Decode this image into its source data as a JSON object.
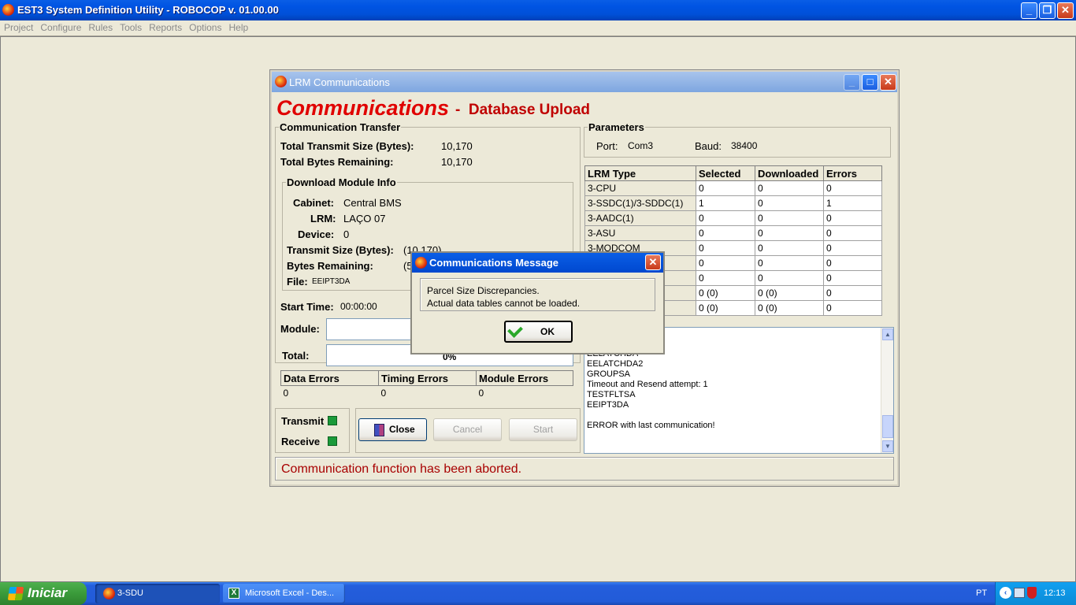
{
  "app": {
    "title": "EST3 System Definition Utility - ROBOCOP v. 01.00.00",
    "menu": [
      "Project",
      "Configure",
      "Rules",
      "Tools",
      "Reports",
      "Options",
      "Help"
    ]
  },
  "lrm": {
    "title": "LRM Communications",
    "heading": "Communications",
    "dash": "-",
    "subheading": "Database Upload",
    "transfer": {
      "legend": "Communication Transfer",
      "total_size_label": "Total Transmit Size (Bytes):",
      "total_size": "10,170",
      "total_remaining_label": "Total Bytes Remaining:",
      "total_remaining": "10,170"
    },
    "module": {
      "legend": "Download Module Info",
      "cabinet_label": "Cabinet:",
      "cabinet": "Central  BMS",
      "lrm_label": "LRM:",
      "lrm": "LAÇO 07",
      "device_label": "Device:",
      "device": "0",
      "size_label": "Transmit Size (Bytes):",
      "size": "(10,170)",
      "remaining_label": "Bytes Remaining:",
      "remaining": "(5",
      "file_label": "File:",
      "file": "EEIPT3DA"
    },
    "start_time_label": "Start Time:",
    "start_time": "00:00:00",
    "module_label": "Module:",
    "total_label": "Total:",
    "total_percent": "0%",
    "errors": {
      "headers": [
        "Data Errors",
        "Timing Errors",
        "Module Errors"
      ],
      "values": [
        "0",
        "0",
        "0"
      ]
    },
    "transmit_label": "Transmit",
    "receive_label": "Receive",
    "buttons": {
      "close": "Close",
      "cancel": "Cancel",
      "start": "Start"
    },
    "params": {
      "legend": "Parameters",
      "port_label": "Port:",
      "port": "Com3",
      "baud_label": "Baud:",
      "baud": "38400"
    },
    "table": {
      "headers": [
        "LRM Type",
        "Selected",
        "Downloaded",
        "Errors"
      ],
      "rows": [
        [
          "3-CPU",
          "0",
          "0",
          "0"
        ],
        [
          "3-SSDC(1)/3-SDDC(1)",
          "1",
          "0",
          "1"
        ],
        [
          "3-AADC(1)",
          "0",
          "0",
          "0"
        ],
        [
          "3-ASU",
          "0",
          "0",
          "0"
        ],
        [
          "3-MODCOM",
          "0",
          "0",
          "0"
        ],
        [
          "",
          "0",
          "0",
          "0"
        ],
        [
          "",
          "0",
          "0",
          "0"
        ],
        [
          "",
          "0 (0)",
          "0 (0)",
          "0"
        ],
        [
          "",
          "0 (0)",
          "0 (0)",
          "0"
        ]
      ]
    },
    "log": [
      "EELATCHDA",
      "EELATCHDA2",
      "GROUPSA",
      "Timeout and Resend attempt: 1",
      "TESTFLTSA",
      "EEIPT3DA",
      "",
      "ERROR with last communication!"
    ],
    "status": "Communication function has been aborted."
  },
  "dialog": {
    "title": "Communications Message",
    "line1": "Parcel Size Discrepancies.",
    "line2": "Actual data tables cannot be loaded.",
    "ok": "OK"
  },
  "taskbar": {
    "start": "Iniciar",
    "tasks": [
      "3-SDU",
      "Microsoft Excel - Des..."
    ],
    "lang": "PT",
    "clock": "12:13"
  }
}
